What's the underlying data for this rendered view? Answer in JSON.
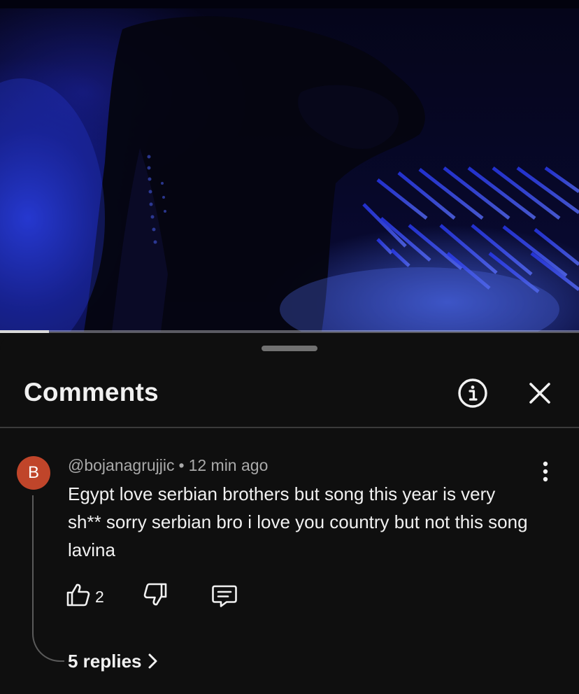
{
  "video": {
    "progress_fraction": 0.085
  },
  "sheet": {
    "title": "Comments",
    "info_icon": "info-icon",
    "close_icon": "close-icon"
  },
  "comment": {
    "avatar_letter": "B",
    "avatar_color": "#c0452a",
    "author": "@bojanagrujjic",
    "separator": "•",
    "time": "12 min ago",
    "text": "Egypt love serbian brothers but song this year is very sh** sorry serbian bro i love you country but not this song lavina",
    "like_count": "2",
    "replies_label": "5 replies",
    "icons": [
      "like-icon",
      "dislike-icon",
      "reply-icon",
      "more-vertical-icon",
      "chevron-right-icon"
    ]
  },
  "colors": {
    "background": "#0f0f0f",
    "text_primary": "#f1f1f1",
    "text_secondary": "#aaaaaa"
  }
}
